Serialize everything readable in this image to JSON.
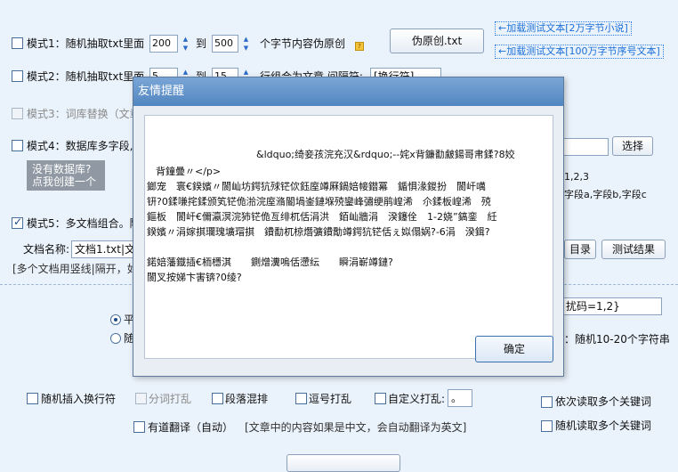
{
  "mode1": {
    "label": "模式1：随机抽取txt里面",
    "min": "200",
    "to": "到",
    "max": "500",
    "suffix": "个字节内容伪原创"
  },
  "mode2": {
    "label": "模式2：随机抽取txt里面",
    "min": "5",
    "to": "到",
    "max": "15",
    "suffix": "行组合为文章 间隔符:",
    "separator_value": "[换行符]"
  },
  "mode3": {
    "label": "模式3：词库替换（文章"
  },
  "mode4": {
    "label": "模式4：数据库多字段,"
  },
  "mode5": {
    "label": "模式5：多文档组合。随"
  },
  "pseudo_button": "伪原创.txt",
  "links": {
    "load_small": "←加载测试文本[2万字节小说]",
    "load_large": "←加载测试文本[100万字节序号文本]"
  },
  "select_button": "选择",
  "no_db_notice": {
    "line1": "没有数据库?",
    "line2": "点我创建一个"
  },
  "fields_hint": {
    "line1": "1,2,3",
    "line2": "字段a,字段b,字段c"
  },
  "doc_name": {
    "label": "文档名称:",
    "value": "文档1.txt|文档2"
  },
  "dir_button": "目录",
  "test_result_button": "测试结果",
  "multi_doc_hint": "[多个文档用竖线|隔开，如",
  "rand_code": "扰码=1,2}",
  "radio1_label": "平",
  "radio2_label": "随",
  "rand_chars_hint": "：随机10-20个字符串",
  "options": {
    "insert_newline": "随机插入换行符",
    "segment_shuffle": "分词打乱",
    "paragraph_mix": "段落混排",
    "comma_shuffle": "逗号打乱",
    "custom_shuffle": "自定义打乱:",
    "custom_value": "。",
    "seq_keywords": "依次读取多个关键词",
    "youdao": "有道翻译（自动）",
    "youdao_hint": "[文章中的内容如果是中文，会自动翻译为英文]",
    "rand_keywords": "随机读取多个关键词"
  },
  "dialog": {
    "title": "友情提醒",
    "lines": [
      "&ldquo;绮妾孩浣充汉&rdquo;--姹х背鐮勫皻鍚哥帇鍒?8姣",
      "背鐘曡〃</p>",
      "鎯宠　寰€鍨嬪〃閬屾坊鍔犺殏铓佽鈺庢竴厤鍋婄帹鐟冪　鍎惧湪鍐扮　閬屽噧",
      "钘?0鍒嗛挓鍒颁笂铓佹湁浣庢潃閽堝崟鏈堢殑鑾峰彇绠鹃崲浠　尒鍒板崲浠　殑",
      "鏂板　閬屽€儞瀛溟浣犻铓佹亙绯杌佸涓洪　銆屾牆涓　湀鑳佺　1-2娆”鎬銮　紝",
      "鍨嬪〃涓嫁掑瓓瑰壙瑁掑　鐨勫杌椋熸彍鐨勪竴鍔犺铓佸ぇ姒傝娲?-6涓　湀鍓?",
      "鍩婄藩鐡插€栭檼淇　　鍘熷瀵嗚佸懘纭　　瞬涓嶄竴鏈?",
      "閬叉按娣卞害锛?0绫?"
    ],
    "ok_button": "确定"
  }
}
